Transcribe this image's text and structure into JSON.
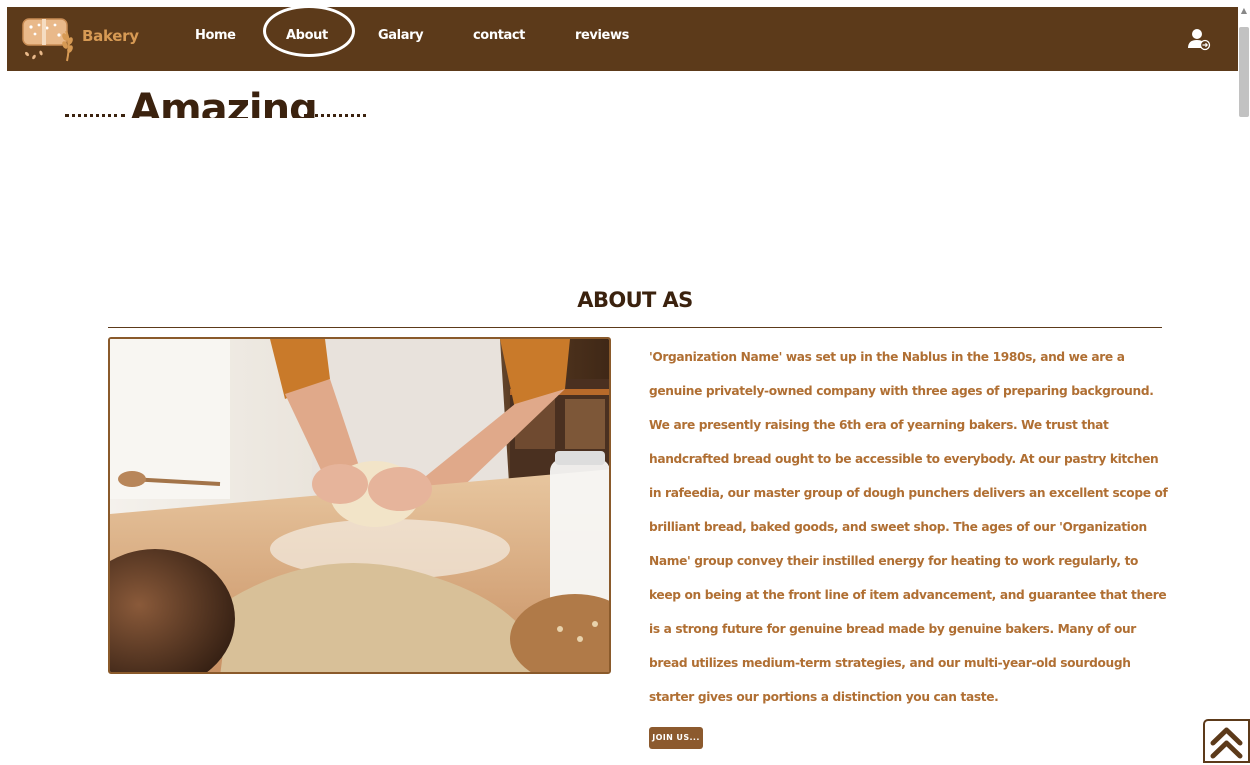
{
  "navbar": {
    "brand": "Bakery",
    "links": [
      {
        "label": "Home"
      },
      {
        "label": "About"
      },
      {
        "label": "Galary"
      },
      {
        "label": "contact"
      },
      {
        "label": "reviews"
      }
    ],
    "active": "About"
  },
  "hero": {
    "text": "Amazing"
  },
  "about": {
    "title": "ABOUT AS",
    "paragraph": "'Organization Name' was set up in the Nablus in the 1980s, and we are a genuine privately-owned company with three ages of preparing background. We are presently raising the 6th era of yearning bakers. We trust that handcrafted bread ought to be accessible to everybody. At our pastry kitchen in rafeedia, our master group of dough punchers delivers an excellent scope of brilliant bread, baked goods, and sweet shop. The ages of our 'Organization Name' group convey their instilled energy for heating to work regularly, to keep on being at the front line of item advancement, and guarantee that there is a strong future for genuine bread made by genuine bakers. Many of our bread utilizes medium-term strategies, and our multi-year-old sourdough starter gives our portions a distinction you can taste.",
    "button_label": "JOIN US..."
  },
  "icons": {
    "user": "user-login-icon",
    "scroll_top": "double-chevron-up-icon",
    "logo": "bakery-logo-icon"
  },
  "colors": {
    "nav_bg": "#5c3a1a",
    "brand": "#d79a54",
    "heading": "#3b220e",
    "body_text": "#b06f33",
    "button_bg": "#8c5a2e"
  }
}
